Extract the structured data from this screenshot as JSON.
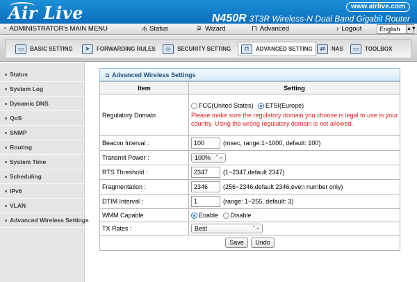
{
  "header": {
    "logo": "Air Live",
    "url": "www.airlive.com",
    "model": "N450R",
    "model_desc": "3T3R Wireless-N Dual Band Gigabit Router"
  },
  "menubar": {
    "items": [
      {
        "label": "ADMINISTRATOR's MAIN MENU",
        "icon": "square-icon"
      },
      {
        "label": "Status",
        "icon": "antenna-icon"
      },
      {
        "label": "Wizard",
        "icon": "wizard-icon"
      },
      {
        "label": "Advanced",
        "icon": "router-icon"
      },
      {
        "label": "Logout",
        "icon": "arrow-icon"
      }
    ],
    "language": "English"
  },
  "tabs": [
    {
      "label": "BASIC SETTING",
      "icon": "folder-icon"
    },
    {
      "label": "FORWARDING RULES",
      "icon": "forward-icon"
    },
    {
      "label": "SECURITY SETTING",
      "icon": "shield-icon"
    },
    {
      "label": "ADVANCED SETTING",
      "icon": "router-icon",
      "active": true
    },
    {
      "label": "NAS",
      "icon": "nas-icon"
    },
    {
      "label": "TOOLBOX",
      "icon": "toolbox-icon"
    }
  ],
  "sidebar": {
    "items": [
      {
        "label": "Status"
      },
      {
        "label": "System Log"
      },
      {
        "label": "Dynamic DNS"
      },
      {
        "label": "QoS"
      },
      {
        "label": "SNMP"
      },
      {
        "label": "Routing"
      },
      {
        "label": "System Time"
      },
      {
        "label": "Scheduling"
      },
      {
        "label": "IPv6"
      },
      {
        "label": "VLAN"
      },
      {
        "label": "Advanced Wireless Settings"
      }
    ]
  },
  "panel": {
    "title": "Advanced Wireless Settings",
    "col_item": "Item",
    "col_setting": "Setting"
  },
  "settings": {
    "regulatory": {
      "label": "Regulatory Domain",
      "opt1": "FCC(United States)",
      "opt2": "ETSI(Europe)",
      "selected": "ETSI(Europe)",
      "warning": "Please make sure the regulatory domain you choose is legal to use in your country. Using the wrong regulatory domain is not allowed."
    },
    "beacon": {
      "label": "Beacon Interval :",
      "value": "100",
      "hint": "(msec, range:1~1000, default: 100)"
    },
    "txpower": {
      "label": "Transmit Power :",
      "value": "100%"
    },
    "rts": {
      "label": "RTS Threshold :",
      "value": "2347",
      "hint": "(1~2347,default 2347)"
    },
    "frag": {
      "label": "Fragmentation :",
      "value": "2346",
      "hint": "(256~2346,default 2346,even number only)"
    },
    "dtim": {
      "label": "DTIM Interval :",
      "value": "1",
      "hint": "(range: 1~255, default: 3)"
    },
    "wmm": {
      "label": "WMM Capable",
      "opt1": "Enable",
      "opt2": "Disable",
      "selected": "Enable"
    },
    "txrates": {
      "label": "TX Rates :",
      "value": "Best"
    }
  },
  "buttons": {
    "save": "Save",
    "undo": "Undo"
  }
}
